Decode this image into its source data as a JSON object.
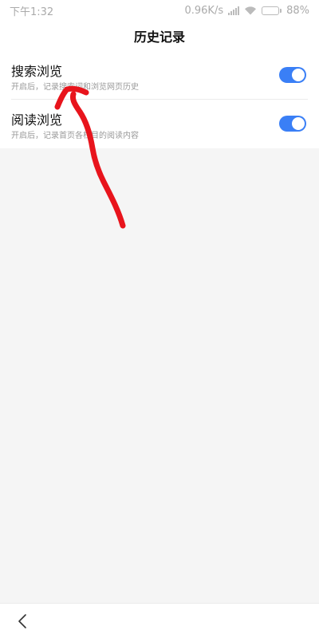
{
  "status_bar": {
    "time": "下午1:32",
    "network_speed": "0.96K/s",
    "battery_percent": "88%",
    "battery_level": 0.88
  },
  "header": {
    "title": "历史记录"
  },
  "settings": [
    {
      "title": "搜索浏览",
      "description": "开启后，记录搜索词和浏览网页历史",
      "enabled": true
    },
    {
      "title": "阅读浏览",
      "description": "开启后，记录首页各栏目的阅读内容",
      "enabled": true
    }
  ],
  "colors": {
    "toggle_on": "#3a7ff6",
    "annotation": "#e8141c"
  },
  "icons": {
    "back": "chevron-left-icon",
    "wifi": "wifi-icon",
    "signal": "signal-icon",
    "battery": "battery-icon"
  }
}
